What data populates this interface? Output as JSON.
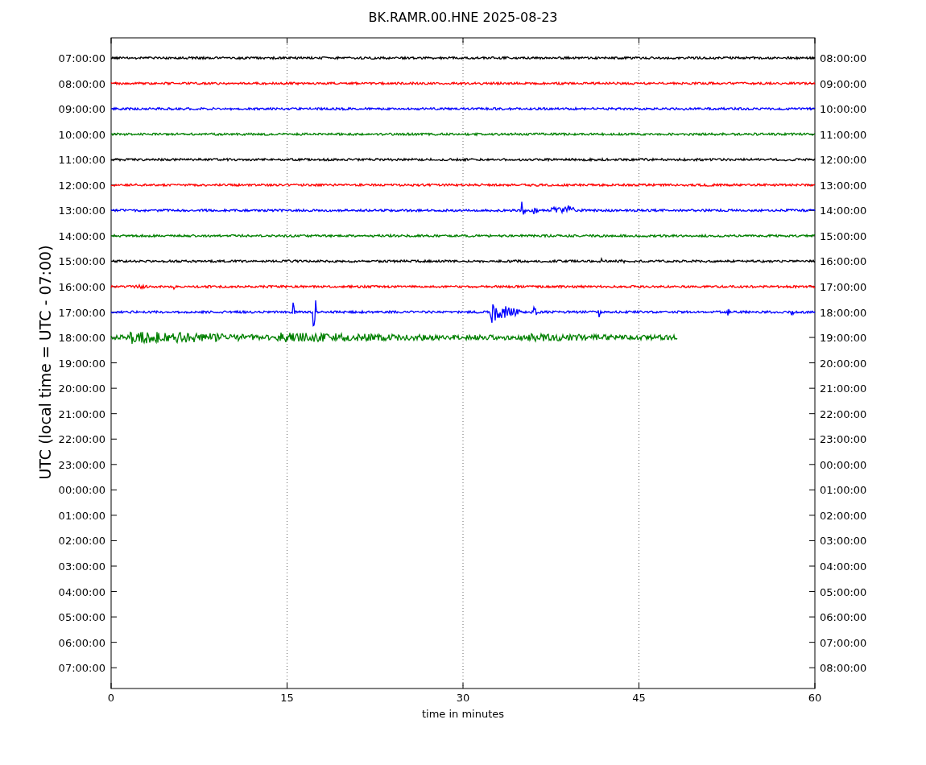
{
  "title": "BK.RAMR.00.HNE 2025-08-23",
  "ylabel": "UTC (local time = UTC - 07:00)",
  "xlabel": "time in minutes",
  "xticks": [
    "0",
    "15",
    "30",
    "45",
    "60"
  ],
  "rows": [
    {
      "left": "07:00:00",
      "right": "08:00:00",
      "color": "#000000",
      "kind": "full"
    },
    {
      "left": "08:00:00",
      "right": "09:00:00",
      "color": "#ff0000",
      "kind": "full"
    },
    {
      "left": "09:00:00",
      "right": "10:00:00",
      "color": "#0000ff",
      "kind": "full"
    },
    {
      "left": "10:00:00",
      "right": "11:00:00",
      "color": "#008000",
      "kind": "full"
    },
    {
      "left": "11:00:00",
      "right": "12:00:00",
      "color": "#000000",
      "kind": "full"
    },
    {
      "left": "12:00:00",
      "right": "13:00:00",
      "color": "#ff0000",
      "kind": "full"
    },
    {
      "left": "13:00:00",
      "right": "14:00:00",
      "color": "#0000ff",
      "kind": "full"
    },
    {
      "left": "14:00:00",
      "right": "15:00:00",
      "color": "#008000",
      "kind": "full"
    },
    {
      "left": "15:00:00",
      "right": "16:00:00",
      "color": "#000000",
      "kind": "full"
    },
    {
      "left": "16:00:00",
      "right": "17:00:00",
      "color": "#ff0000",
      "kind": "full"
    },
    {
      "left": "17:00:00",
      "right": "18:00:00",
      "color": "#0000ff",
      "kind": "full"
    },
    {
      "left": "18:00:00",
      "right": "19:00:00",
      "color": "#008000",
      "kind": "partial"
    },
    {
      "left": "19:00:00",
      "right": "20:00:00",
      "kind": "none"
    },
    {
      "left": "20:00:00",
      "right": "21:00:00",
      "kind": "none"
    },
    {
      "left": "21:00:00",
      "right": "22:00:00",
      "kind": "none"
    },
    {
      "left": "22:00:00",
      "right": "23:00:00",
      "kind": "none"
    },
    {
      "left": "23:00:00",
      "right": "00:00:00",
      "kind": "none"
    },
    {
      "left": "00:00:00",
      "right": "01:00:00",
      "kind": "none"
    },
    {
      "left": "01:00:00",
      "right": "02:00:00",
      "kind": "none"
    },
    {
      "left": "02:00:00",
      "right": "03:00:00",
      "kind": "none"
    },
    {
      "left": "03:00:00",
      "right": "04:00:00",
      "kind": "none"
    },
    {
      "left": "04:00:00",
      "right": "05:00:00",
      "kind": "none"
    },
    {
      "left": "05:00:00",
      "right": "06:00:00",
      "kind": "none"
    },
    {
      "left": "06:00:00",
      "right": "07:00:00",
      "kind": "none"
    },
    {
      "left": "07:00:00",
      "right": "08:00:00",
      "kind": "none"
    }
  ]
}
